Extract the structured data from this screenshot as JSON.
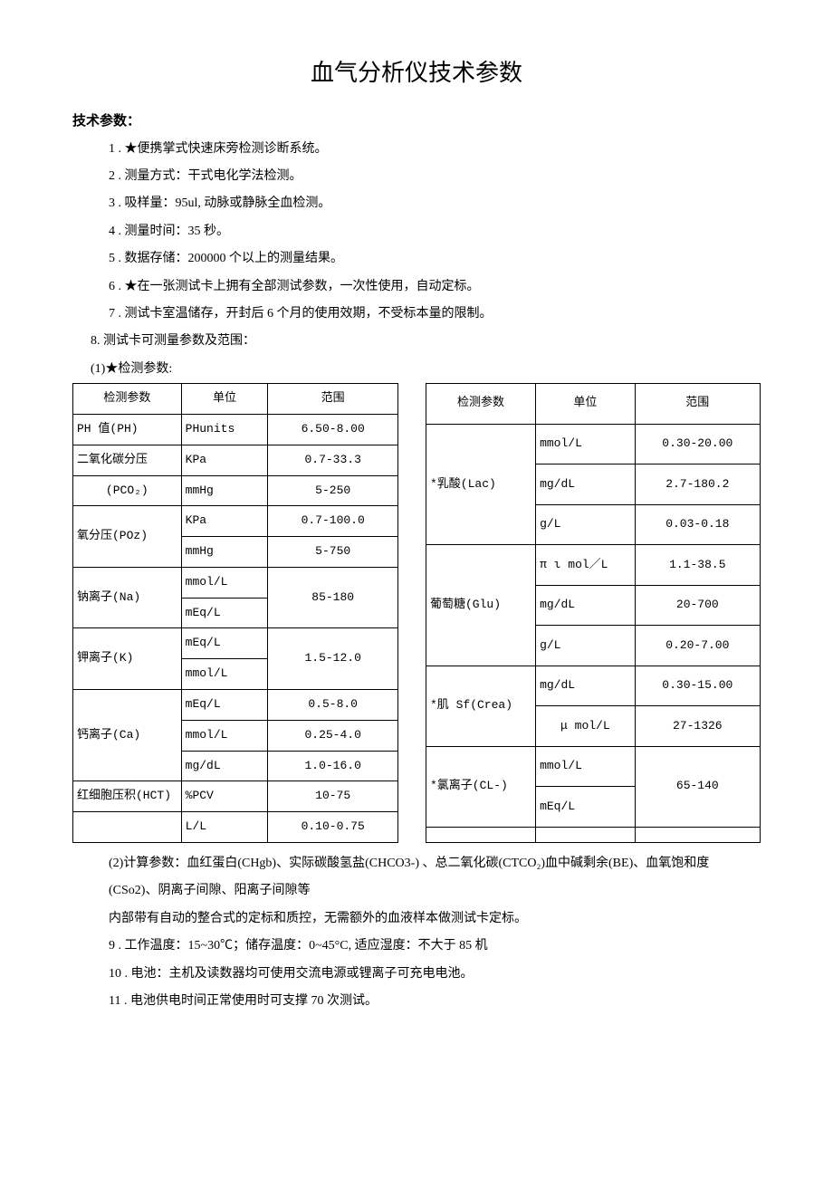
{
  "title": "血气分析仪技术参数",
  "section_head": "技术参数：",
  "specs": {
    "s1": "1 . ★便携掌式快速床旁检测诊断系统。",
    "s2": "2 . 测量方式：干式电化学法检测。",
    "s3": "3 . 吸样量：95ul, 动脉或静脉全血检测。",
    "s4": "4 . 测量时间：35 秒。",
    "s5": "5 . 数据存储：200000 个以上的测量结果。",
    "s6": "6 . ★在一张测试卡上拥有全部测试参数，一次性使用，自动定标。",
    "s7": "7 . 测试卡室温储存，开封后 6 个月的使用效期，不受标本量的限制。",
    "s8": "8. 测试卡可测量参数及范围：",
    "s8_1": "(1)★检测参数:"
  },
  "table_headers": {
    "param": "检测参数",
    "unit": "单位",
    "range": "范围"
  },
  "left_table": [
    {
      "param": "PH 值(PH)",
      "unit": "PHunits",
      "range": "6.50-8.00"
    },
    {
      "param": "二氧化碳分压",
      "unit": "KPa",
      "range": "0.7-33.3"
    },
    {
      "param": "(PCO₂)",
      "unit": "mmHg",
      "range": "5-250"
    },
    {
      "param_rs2": "氧分压(POz)",
      "unit": "KPa",
      "range": "0.7-100.0"
    },
    {
      "unit": "mmHg",
      "range": "5-750"
    },
    {
      "param_rs2": "钠离子(Na)",
      "unit": "mmol/L",
      "range_rs2": "85-180"
    },
    {
      "unit": "mEq/L"
    },
    {
      "param_rs2": "钾离子(K)",
      "unit": "mEq/L",
      "range_rs2": "1.5-12.0"
    },
    {
      "unit": "mmol/L"
    },
    {
      "param_rs3": "钙离子(Ca)",
      "unit": "mEq/L",
      "range": "0.5-8.0"
    },
    {
      "unit": "mmol/L",
      "range": "0.25-4.0"
    },
    {
      "unit": "mg/dL",
      "range": "1.0-16.0"
    },
    {
      "param": "红细胞压积(HCT)",
      "unit": "%PCV",
      "range": "10-75"
    },
    {
      "param": "",
      "unit": "L/L",
      "range": "0.10-0.75"
    }
  ],
  "right_table": [
    {
      "param_rs3": "*乳酸(Lac)",
      "unit": "mmol/L",
      "range": "0.30-20.00"
    },
    {
      "unit": "mg/dL",
      "range": "2.7-180.2"
    },
    {
      "unit": "g/L",
      "range": "0.03-0.18"
    },
    {
      "param_rs3": "葡萄糖(Glu)",
      "unit": "π ι mol／L",
      "range": "1.1-38.5"
    },
    {
      "unit": "mg/dL",
      "range": "20-700"
    },
    {
      "unit": "g/L",
      "range": "0.20-7.00"
    },
    {
      "param_rs2": "*肌 Sf(Crea)",
      "unit": "mg/dL",
      "range": "0.30-15.00"
    },
    {
      "unit": "μ mol/L",
      "range": "27-1326"
    },
    {
      "param_rs2": "*氯离子(CL-)",
      "unit": "mmol/L",
      "range_rs2": "65-140"
    },
    {
      "unit": "mEq/L"
    },
    {
      "param": "",
      "unit": "",
      "range": ""
    }
  ],
  "after": {
    "a1": "(2)计算参数：血红蛋白(CHgb)、实际碳酸氢盐(CHCO3-) 、总二氧化碳(CTCO₂)血中碱剩余(BE)、血氧饱和度",
    "a2": "(CSo2)、阴离子间隙、阳离子间隙等",
    "a3": "内部带有自动的整合式的定标和质控，无需额外的血液样本做测试卡定标。",
    "a4": "9 . 工作温度：15~30℃；储存温度：0~45°C, 适应湿度：不大于 85 机",
    "a5": "10 . 电池：主机及读数器均可使用交流电源或锂离子可充电电池。",
    "a6": "11 . 电池供电时间正常使用时可支撑 70 次测试。"
  }
}
